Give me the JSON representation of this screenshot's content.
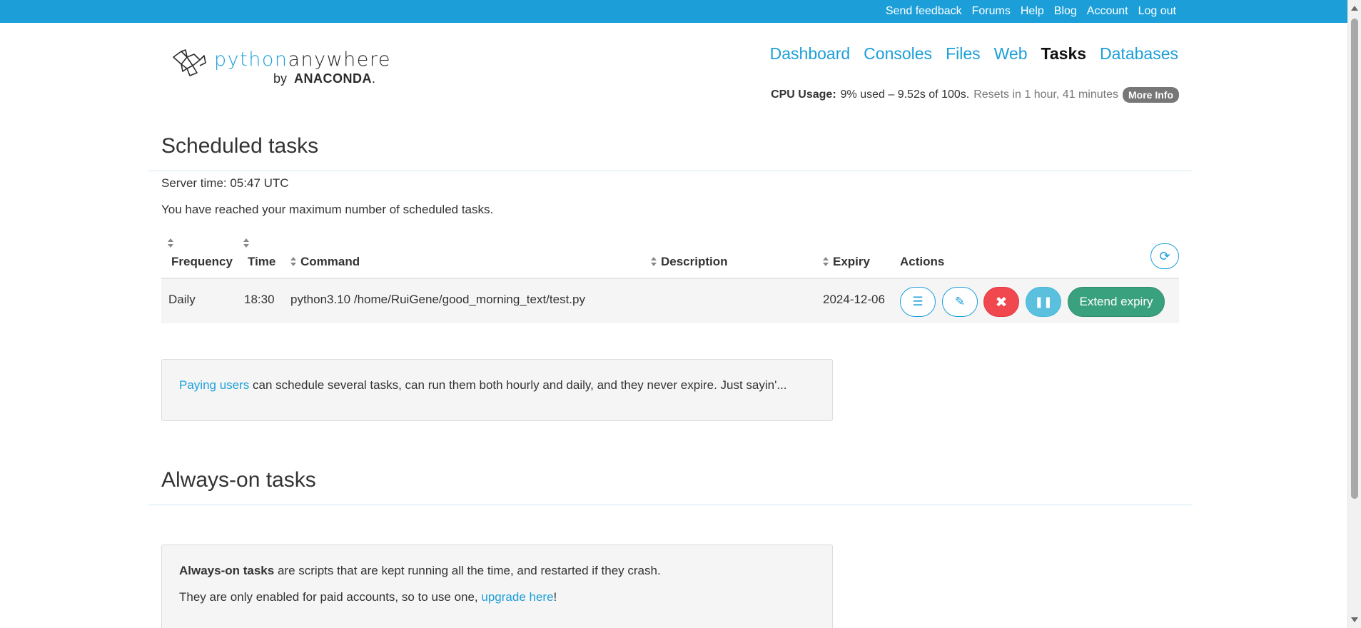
{
  "topbar": {
    "links": [
      "Send feedback",
      "Forums",
      "Help",
      "Blog",
      "Account",
      "Log out"
    ]
  },
  "logo": {
    "python": "python",
    "anywhere": "anywhere",
    "by": "by",
    "company": "ANACONDA",
    "dot": "."
  },
  "nav": {
    "items": [
      "Dashboard",
      "Consoles",
      "Files",
      "Web",
      "Tasks",
      "Databases"
    ],
    "active": "Tasks"
  },
  "cpu": {
    "label": "CPU Usage:",
    "usage": "9% used – 9.52s of 100s.",
    "resets": "Resets in 1 hour, 41 minutes",
    "more_info": "More Info"
  },
  "scheduled": {
    "title": "Scheduled tasks",
    "server_time": "Server time: 05:47 UTC",
    "max_message": "You have reached your maximum number of scheduled tasks.",
    "columns": {
      "frequency": "Frequency",
      "time": "Time",
      "command": "Command",
      "description": "Description",
      "expiry": "Expiry",
      "actions": "Actions"
    },
    "row": {
      "frequency": "Daily",
      "time": "18:30",
      "command": "python3.10 /home/RuiGene/good_morning_text/test.py",
      "description": "",
      "expiry": "2024-12-06",
      "extend_label": "Extend expiry"
    },
    "paying_link": "Paying users",
    "paying_text": " can schedule several tasks, can run them both hourly and daily, and they never expire. Just sayin'..."
  },
  "always_on": {
    "title": "Always-on tasks",
    "intro_bold": "Always-on tasks",
    "intro_rest": " are scripts that are kept running all the time, and restarted if they crash.",
    "paid_text": "They are only enabled for paid accounts, so to use one, ",
    "upgrade_link": "upgrade here",
    "excl": "!"
  },
  "colors": {
    "brand": "#1c9fd9",
    "danger": "#f0484e",
    "info": "#5bc0de",
    "success": "#3aa17e"
  }
}
